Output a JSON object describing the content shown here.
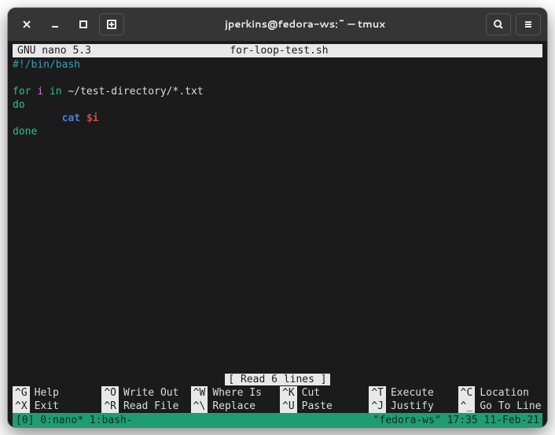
{
  "window": {
    "title": "jperkins@fedora-ws:~ — tmux"
  },
  "nano": {
    "app": "GNU nano 5.3",
    "filename": "for-loop-test.sh",
    "status": "[ Read 6 lines ]",
    "lines": {
      "shebang": "#!/bin/bash",
      "for": "for",
      "var": "i",
      "in": "in",
      "glob": "~/test-directory/*.txt",
      "do": "do",
      "indent": "        ",
      "cat": "cat",
      "ref": "$i",
      "done": "done"
    },
    "shortcuts": [
      {
        "key": "^G",
        "label": "Help"
      },
      {
        "key": "^O",
        "label": "Write Out"
      },
      {
        "key": "^W",
        "label": "Where Is"
      },
      {
        "key": "^K",
        "label": "Cut"
      },
      {
        "key": "^T",
        "label": "Execute"
      },
      {
        "key": "^C",
        "label": "Location"
      },
      {
        "key": "^X",
        "label": "Exit"
      },
      {
        "key": "^R",
        "label": "Read File"
      },
      {
        "key": "^\\",
        "label": "Replace"
      },
      {
        "key": "^U",
        "label": "Paste"
      },
      {
        "key": "^J",
        "label": "Justify"
      },
      {
        "key": "^_",
        "label": "Go To Line"
      }
    ]
  },
  "tmux": {
    "left": "[0] 0:nano* 1:bash-",
    "right": "\"fedora-ws\" 17:35 11-Feb-21"
  }
}
